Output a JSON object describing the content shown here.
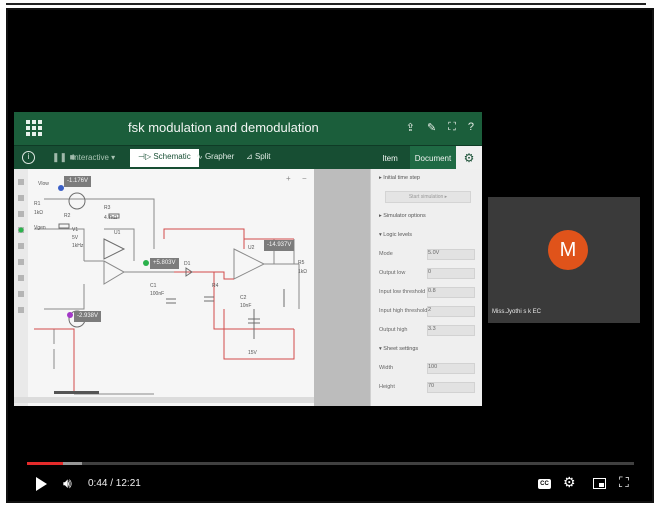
{
  "app": {
    "title": "fsk modulation and demodulation",
    "mode_label": "Interactive ▾",
    "tabs": [
      "Schematic",
      "Grapher",
      "Split"
    ],
    "panel_tabs": [
      "Item",
      "Document"
    ],
    "appbar_icons": [
      "share-icon",
      "edit-icon",
      "fullscreen-icon",
      "help-icon"
    ]
  },
  "sidebar": {
    "rows": [
      {
        "label": "Initial time step"
      },
      {
        "label": "Start simulation ▸"
      },
      {
        "label": "Simulator options"
      },
      {
        "label": "Logic levels"
      },
      {
        "label": "Mode",
        "value": "5.0V"
      },
      {
        "label": "Output low",
        "value": "0"
      },
      {
        "label": "Input low threshold",
        "value": "0.8"
      },
      {
        "label": "Input high threshold",
        "value": "2"
      },
      {
        "label": "Output high",
        "value": "3.3"
      },
      {
        "label": "Sheet settings"
      },
      {
        "label": "Width",
        "value": "100"
      },
      {
        "label": "Height",
        "value": "70"
      }
    ]
  },
  "schematic": {
    "labels": [
      "-1.176V",
      "+5.803V",
      "-14.937V",
      "-2.938V"
    ],
    "components": [
      "R1",
      "1kΩ",
      "Vgen",
      "R2",
      "V1",
      "5V",
      "1kHz",
      "R3",
      "4.7kΩ",
      "U1",
      "C1",
      "100nF",
      "D1",
      "R4",
      "U2",
      "C2",
      "10nF",
      "15V",
      "R5",
      "1kΩ"
    ]
  },
  "participant": {
    "initial": "M",
    "name": "Miss.Jyothi s k EC",
    "color": "#e0531a"
  },
  "player": {
    "time": "0:44 / 12:21",
    "played_fraction": 0.06,
    "loaded_fraction": 0.09,
    "accent": "#e52b2b"
  }
}
